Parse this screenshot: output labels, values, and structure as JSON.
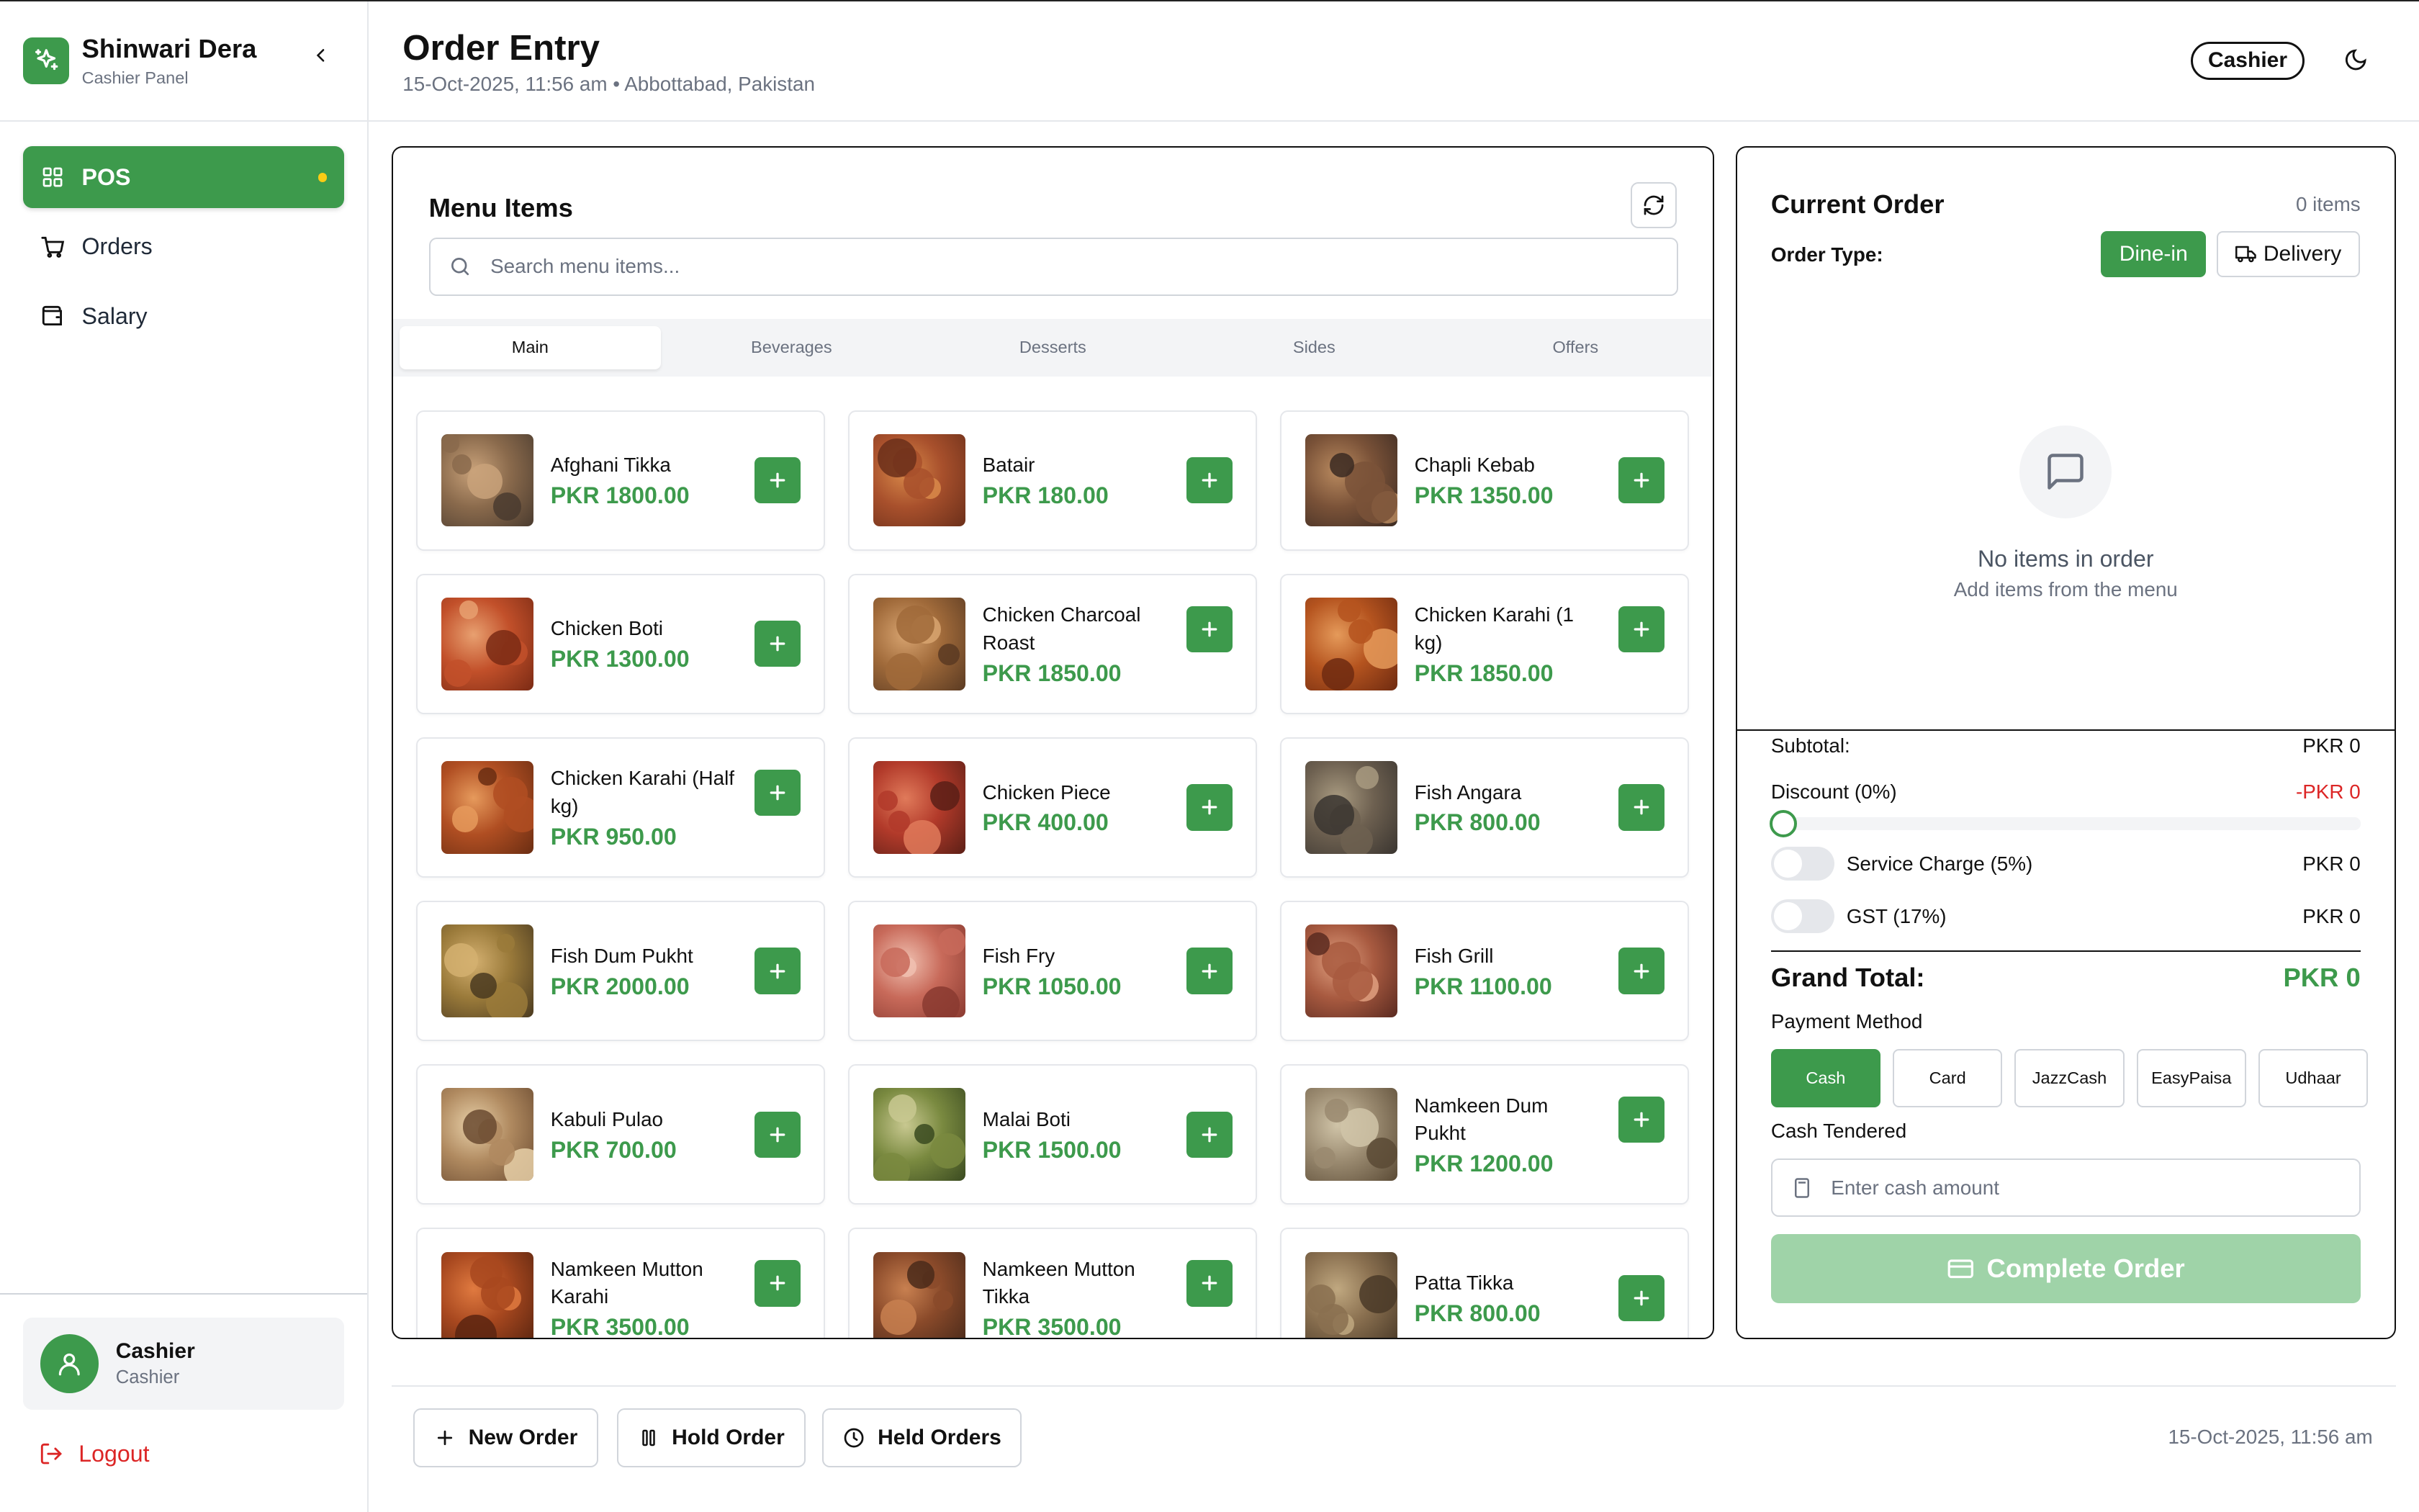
{
  "sidebar": {
    "brand_name": "Shinwari Dera",
    "brand_sub": "Cashier Panel",
    "items": [
      {
        "label": "POS"
      },
      {
        "label": "Orders"
      },
      {
        "label": "Salary"
      }
    ],
    "user": {
      "name": "Cashier",
      "role": "Cashier"
    },
    "logout_label": "Logout"
  },
  "header": {
    "title": "Order Entry",
    "subtitle": "15-Oct-2025, 11:56 am • Abbottabad, Pakistan",
    "role_badge": "Cashier"
  },
  "menu": {
    "title": "Menu Items",
    "search_placeholder": "Search menu items...",
    "tabs": [
      "Main",
      "Beverages",
      "Desserts",
      "Sides",
      "Offers"
    ],
    "active_tab": "Main",
    "items": [
      {
        "name": "Afghani Tikka",
        "price": "PKR 1800.00"
      },
      {
        "name": "Batair",
        "price": "PKR 180.00"
      },
      {
        "name": "Chapli Kebab",
        "price": "PKR 1350.00"
      },
      {
        "name": "Chicken Boti",
        "price": "PKR 1300.00"
      },
      {
        "name": "Chicken Charcoal Roast",
        "price": "PKR 1850.00"
      },
      {
        "name": "Chicken Karahi (1 kg)",
        "price": "PKR 1850.00"
      },
      {
        "name": "Chicken Karahi (Half kg)",
        "price": "PKR 950.00"
      },
      {
        "name": "Chicken Piece",
        "price": "PKR 400.00"
      },
      {
        "name": "Fish Angara",
        "price": "PKR 800.00"
      },
      {
        "name": "Fish Dum Pukht",
        "price": "PKR 2000.00"
      },
      {
        "name": "Fish Fry",
        "price": "PKR 1050.00"
      },
      {
        "name": "Fish Grill",
        "price": "PKR 1100.00"
      },
      {
        "name": "Kabuli Pulao",
        "price": "PKR 700.00"
      },
      {
        "name": "Malai Boti",
        "price": "PKR 1500.00"
      },
      {
        "name": "Namkeen Dum Pukht",
        "price": "PKR 1200.00"
      },
      {
        "name": "Namkeen Mutton Karahi",
        "price": "PKR 3500.00"
      },
      {
        "name": "Namkeen Mutton Tikka",
        "price": "PKR 3500.00"
      },
      {
        "name": "Patta Tikka",
        "price": "PKR 800.00"
      }
    ]
  },
  "order": {
    "title": "Current Order",
    "count": "0 items",
    "type_label": "Order Type:",
    "dine_in": "Dine-in",
    "delivery": "Delivery",
    "empty_title": "No items in order",
    "empty_sub": "Add items from the menu",
    "subtotal_label": "Subtotal:",
    "subtotal_value": "PKR 0",
    "discount_label": "Discount (0%)",
    "discount_value": "-PKR 0",
    "discount_percent": 0,
    "service_label": "Service Charge (5%)",
    "service_value": "PKR 0",
    "gst_label": "GST (17%)",
    "gst_value": "PKR 0",
    "grand_label": "Grand Total:",
    "grand_value": "PKR 0",
    "payment_label": "Payment Method",
    "payment_methods": [
      "Cash",
      "Card",
      "JazzCash",
      "EasyPaisa",
      "Udhaar"
    ],
    "payment_selected": "Cash",
    "cash_label": "Cash Tendered",
    "cash_placeholder": "Enter cash amount",
    "complete_label": "Complete Order"
  },
  "footer": {
    "new_order": "New Order",
    "hold_order": "Hold Order",
    "held_orders": "Held Orders",
    "timestamp": "15-Oct-2025, 11:56 am"
  },
  "colors": {
    "accent": "#3d9a4c",
    "danger": "#dc2626"
  }
}
